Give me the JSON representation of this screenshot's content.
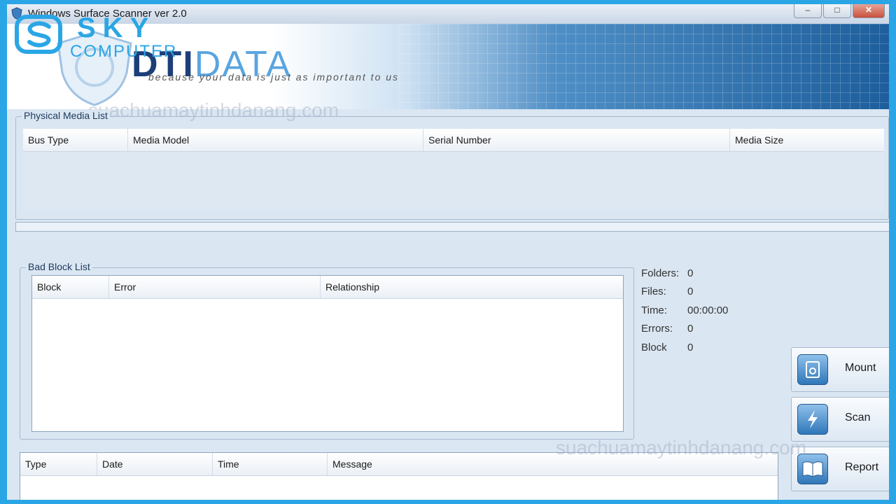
{
  "window": {
    "title": "Windows Surface Scanner ver 2.0",
    "controls": {
      "minimize": "–",
      "maximize": "□",
      "close": "✕"
    }
  },
  "banner": {
    "brand_dti": "DTI",
    "brand_data": "DATA",
    "tagline": "because your data is just as important to us",
    "overlay_logo": {
      "word": "SKY",
      "sub": "COMPUTER"
    }
  },
  "watermarks": [
    "suachuamaytinhdanang.com",
    "suachuamaytinhdanang.com"
  ],
  "physical_media": {
    "label": "Physical Media List",
    "columns": [
      "Bus Type",
      "Media Model",
      "Serial Number",
      "Media Size"
    ],
    "rows": []
  },
  "bad_block": {
    "label": "Bad Block List",
    "columns": [
      "Block",
      "Error",
      "Relationship"
    ],
    "rows": []
  },
  "log": {
    "columns": [
      "Type",
      "Date",
      "Time",
      "Message"
    ],
    "rows": []
  },
  "stats": {
    "folders": {
      "label": "Folders:",
      "value": "0"
    },
    "files": {
      "label": "Files:",
      "value": "0"
    },
    "time": {
      "label": "Time:",
      "value": "00:00:00"
    },
    "errors": {
      "label": "Errors:",
      "value": "0"
    },
    "block": {
      "label": "Block",
      "value": "0"
    }
  },
  "actions": {
    "mount": "Mount",
    "scan": "Scan",
    "report": "Report"
  },
  "colors": {
    "accent": "#2aa6e6",
    "brand_dark": "#1c3f7a",
    "window_bg": "#dae6f2"
  }
}
